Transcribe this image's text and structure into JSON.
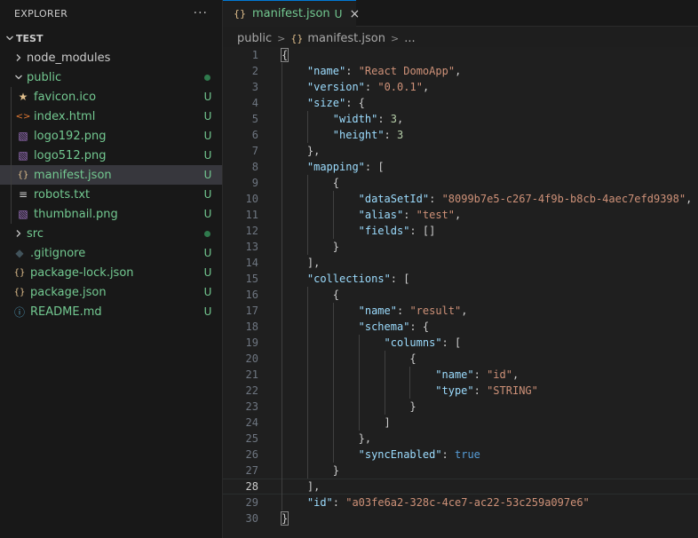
{
  "explorer": {
    "title": "EXPLORER",
    "more": "···",
    "root": "TEST",
    "items": [
      {
        "label": "node_modules",
        "type": "folder",
        "collapsed": true,
        "depth": 0,
        "badge": "",
        "dot": false,
        "color": "#cccccc"
      },
      {
        "label": "public",
        "type": "folder",
        "collapsed": false,
        "depth": 0,
        "badge": "",
        "dot": true,
        "color": "#73c991"
      },
      {
        "label": "favicon.ico",
        "type": "star",
        "depth": 1,
        "badge": "U",
        "color": "#73c991",
        "icon_color": "#e2c08d"
      },
      {
        "label": "index.html",
        "type": "html",
        "depth": 1,
        "badge": "U",
        "color": "#73c991",
        "icon_color": "#e37933"
      },
      {
        "label": "logo192.png",
        "type": "image",
        "depth": 1,
        "badge": "U",
        "color": "#73c991",
        "icon_color": "#a074c4"
      },
      {
        "label": "logo512.png",
        "type": "image",
        "depth": 1,
        "badge": "U",
        "color": "#73c991",
        "icon_color": "#a074c4"
      },
      {
        "label": "manifest.json",
        "type": "json",
        "depth": 1,
        "badge": "U",
        "color": "#73c991",
        "icon_color": "#e2c08d",
        "selected": true
      },
      {
        "label": "robots.txt",
        "type": "text",
        "depth": 1,
        "badge": "U",
        "color": "#73c991",
        "icon_color": "#cccccc"
      },
      {
        "label": "thumbnail.png",
        "type": "image",
        "depth": 1,
        "badge": "U",
        "color": "#73c991",
        "icon_color": "#a074c4"
      },
      {
        "label": "src",
        "type": "folder",
        "collapsed": true,
        "depth": 0,
        "badge": "",
        "dot": true,
        "color": "#73c991"
      },
      {
        "label": ".gitignore",
        "type": "git",
        "depth": 0,
        "badge": "U",
        "color": "#73c991",
        "icon_color": "#41535b"
      },
      {
        "label": "package-lock.json",
        "type": "json",
        "depth": 0,
        "badge": "U",
        "color": "#73c991",
        "icon_color": "#e2c08d"
      },
      {
        "label": "package.json",
        "type": "json",
        "depth": 0,
        "badge": "U",
        "color": "#73c991",
        "icon_color": "#e2c08d"
      },
      {
        "label": "README.md",
        "type": "info",
        "depth": 0,
        "badge": "U",
        "color": "#73c991",
        "icon_color": "#519aba"
      }
    ]
  },
  "tab": {
    "icon": "{}",
    "label": "manifest.json",
    "badge": "U",
    "close": "×"
  },
  "breadcrumb": {
    "folder": "public",
    "file": "manifest.json",
    "more": "..."
  },
  "editor": {
    "current_line": 28,
    "lines": [
      [
        [
          "p",
          "{"
        ]
      ],
      [
        [
          "k",
          "\"name\""
        ],
        [
          "p",
          ": "
        ],
        [
          "s",
          "\"React DomoApp\""
        ],
        [
          "p",
          ","
        ]
      ],
      [
        [
          "k",
          "\"version\""
        ],
        [
          "p",
          ": "
        ],
        [
          "s",
          "\"0.0.1\""
        ],
        [
          "p",
          ","
        ]
      ],
      [
        [
          "k",
          "\"size\""
        ],
        [
          "p",
          ": {"
        ]
      ],
      [
        [
          "k",
          "\"width\""
        ],
        [
          "p",
          ": "
        ],
        [
          "n",
          "3"
        ],
        [
          "p",
          ","
        ]
      ],
      [
        [
          "k",
          "\"height\""
        ],
        [
          "p",
          ": "
        ],
        [
          "n",
          "3"
        ]
      ],
      [
        [
          "p",
          "},"
        ]
      ],
      [
        [
          "k",
          "\"mapping\""
        ],
        [
          "p",
          ": ["
        ]
      ],
      [
        [
          "p",
          "{"
        ]
      ],
      [
        [
          "k",
          "\"dataSetId\""
        ],
        [
          "p",
          ": "
        ],
        [
          "s",
          "\"8099b7e5-c267-4f9b-b8cb-4aec7efd9398\""
        ],
        [
          "p",
          ","
        ]
      ],
      [
        [
          "k",
          "\"alias\""
        ],
        [
          "p",
          ": "
        ],
        [
          "s",
          "\"test\""
        ],
        [
          "p",
          ","
        ]
      ],
      [
        [
          "k",
          "\"fields\""
        ],
        [
          "p",
          ": []"
        ]
      ],
      [
        [
          "p",
          "}"
        ]
      ],
      [
        [
          "p",
          "],"
        ]
      ],
      [
        [
          "k",
          "\"collections\""
        ],
        [
          "p",
          ": ["
        ]
      ],
      [
        [
          "p",
          "{"
        ]
      ],
      [
        [
          "k",
          "\"name\""
        ],
        [
          "p",
          ": "
        ],
        [
          "s",
          "\"result\""
        ],
        [
          "p",
          ","
        ]
      ],
      [
        [
          "k",
          "\"schema\""
        ],
        [
          "p",
          ": {"
        ]
      ],
      [
        [
          "k",
          "\"columns\""
        ],
        [
          "p",
          ": ["
        ]
      ],
      [
        [
          "p",
          "{"
        ]
      ],
      [
        [
          "k",
          "\"name\""
        ],
        [
          "p",
          ": "
        ],
        [
          "s",
          "\"id\""
        ],
        [
          "p",
          ","
        ]
      ],
      [
        [
          "k",
          "\"type\""
        ],
        [
          "p",
          ": "
        ],
        [
          "s",
          "\"STRING\""
        ]
      ],
      [
        [
          "p",
          "}"
        ]
      ],
      [
        [
          "p",
          "]"
        ]
      ],
      [
        [
          "p",
          "},"
        ]
      ],
      [
        [
          "k",
          "\"syncEnabled\""
        ],
        [
          "p",
          ": "
        ],
        [
          "b",
          "true"
        ]
      ],
      [
        [
          "p",
          "}"
        ]
      ],
      [
        [
          "p",
          "],"
        ]
      ],
      [
        [
          "k",
          "\"id\""
        ],
        [
          "p",
          ": "
        ],
        [
          "s",
          "\"a03fe6a2-328c-4ce7-ac22-53c259a097e6\""
        ]
      ],
      [
        [
          "p",
          "}"
        ]
      ]
    ]
  }
}
